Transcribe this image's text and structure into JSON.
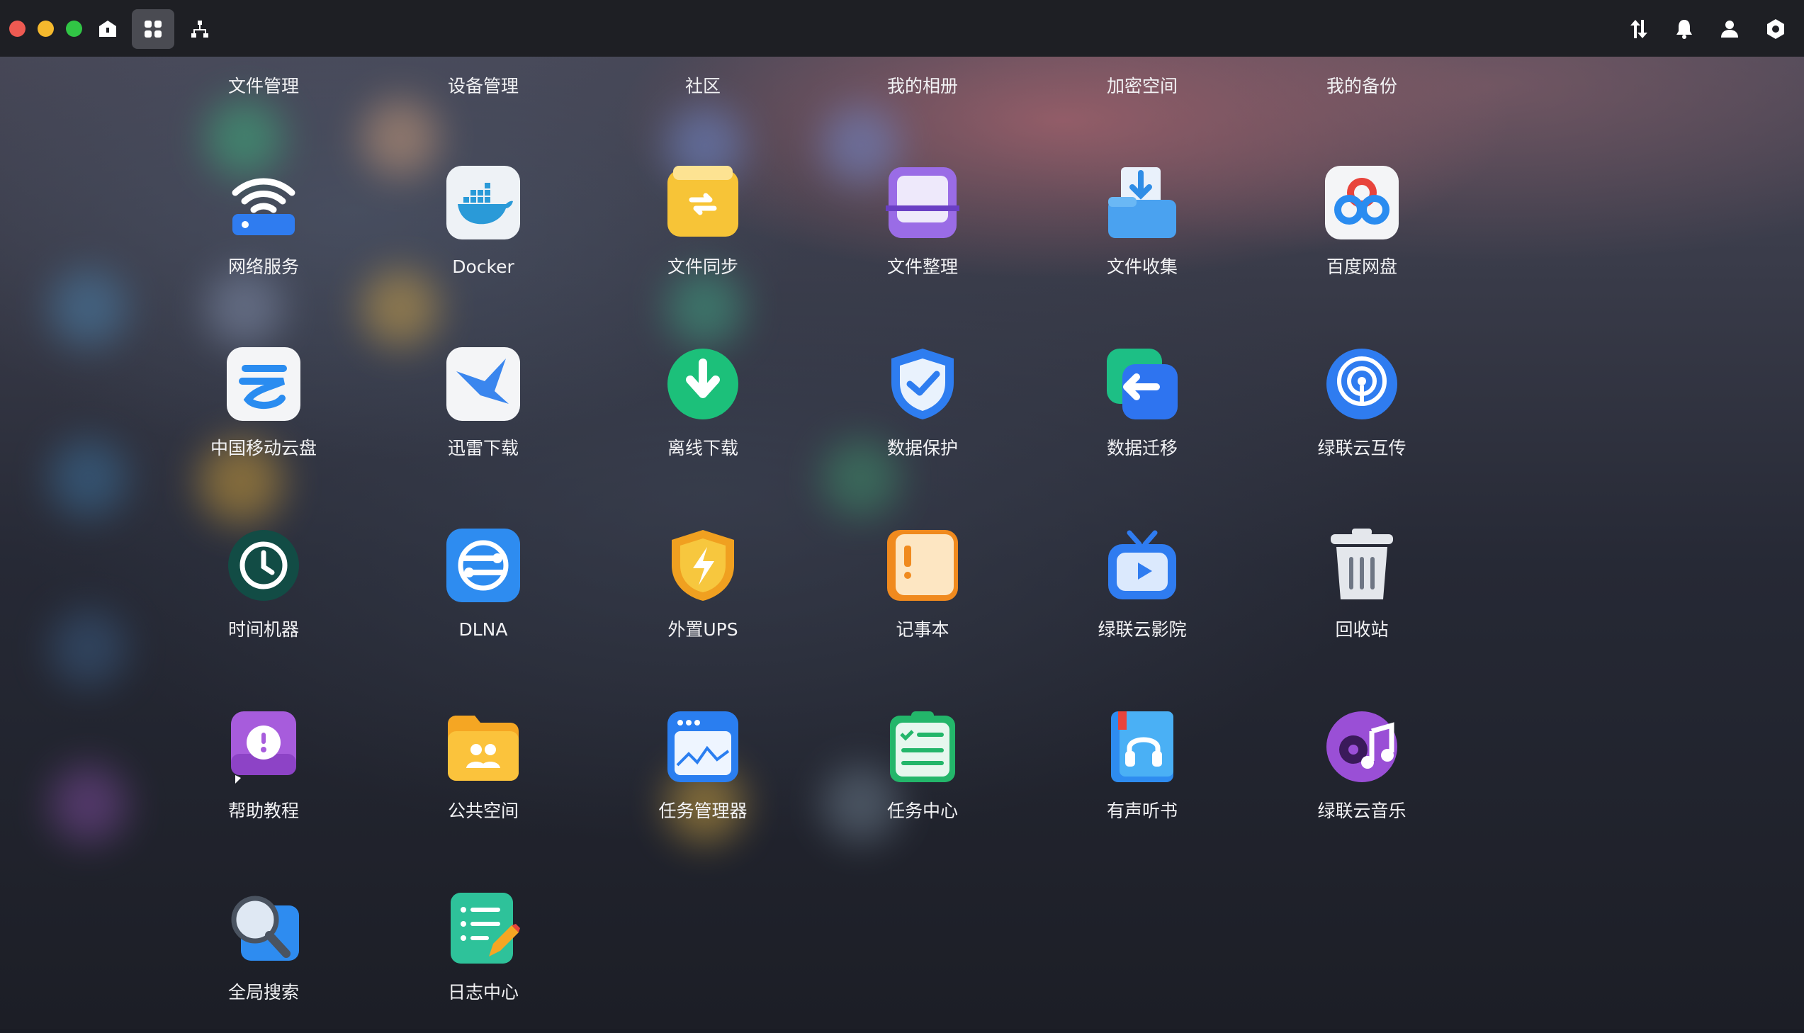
{
  "topbar": {
    "window_controls": [
      "close-dot",
      "minimize-dot",
      "maximize-dot"
    ],
    "left_icons": [
      "home-icon",
      "app-grid-icon",
      "network-tree-icon"
    ],
    "right_icons": [
      "transfer-icon",
      "bell-icon",
      "user-icon",
      "settings-hexagon-icon"
    ]
  },
  "top_row_labels": [
    "文件管理",
    "设备管理",
    "社区",
    "我的相册",
    "加密空间",
    "我的备份"
  ],
  "apps": [
    {
      "label": "网络服务",
      "icon": "wifi-router-icon"
    },
    {
      "label": "Docker",
      "icon": "docker-whale-icon"
    },
    {
      "label": "文件同步",
      "icon": "file-sync-icon"
    },
    {
      "label": "文件整理",
      "icon": "file-organize-icon"
    },
    {
      "label": "文件收集",
      "icon": "file-collect-icon"
    },
    {
      "label": "百度网盘",
      "icon": "baidu-netdisk-icon"
    },
    {
      "label": "中国移动云盘",
      "icon": "china-mobile-cloud-icon"
    },
    {
      "label": "迅雷下载",
      "icon": "xunlei-bird-icon"
    },
    {
      "label": "离线下载",
      "icon": "offline-download-icon"
    },
    {
      "label": "数据保护",
      "icon": "shield-check-icon"
    },
    {
      "label": "数据迁移",
      "icon": "data-migration-icon"
    },
    {
      "label": "绿联云互传",
      "icon": "airdrop-signal-icon"
    },
    {
      "label": "时间机器",
      "icon": "time-machine-icon"
    },
    {
      "label": "DLNA",
      "icon": "dlna-icon"
    },
    {
      "label": "外置UPS",
      "icon": "ups-lightning-icon"
    },
    {
      "label": "记事本",
      "icon": "notepad-icon"
    },
    {
      "label": "绿联云影院",
      "icon": "tv-play-icon"
    },
    {
      "label": "回收站",
      "icon": "trash-bin-icon"
    },
    {
      "label": "帮助教程",
      "icon": "help-tutorial-icon"
    },
    {
      "label": "公共空间",
      "icon": "public-folder-icon"
    },
    {
      "label": "任务管理器",
      "icon": "task-manager-icon"
    },
    {
      "label": "任务中心",
      "icon": "task-center-icon"
    },
    {
      "label": "有声听书",
      "icon": "audiobook-icon"
    },
    {
      "label": "绿联云音乐",
      "icon": "music-disc-icon"
    },
    {
      "label": "全局搜索",
      "icon": "magnifier-search-icon"
    },
    {
      "label": "日志中心",
      "icon": "log-center-icon"
    }
  ],
  "colors": {
    "topbar": "#1e1f24",
    "close": "#ee5a52",
    "minimize": "#f5b92d",
    "maximize": "#31c545",
    "active_tab": "#4a4b52"
  }
}
